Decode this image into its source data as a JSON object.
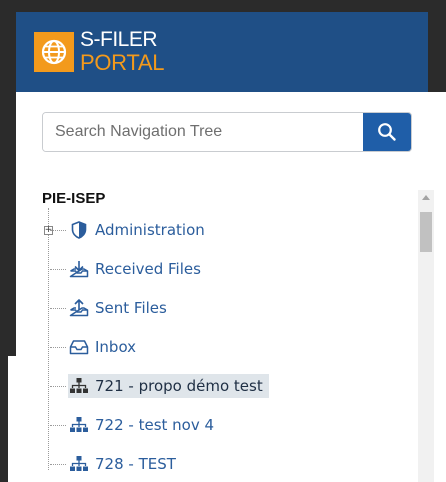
{
  "logo": {
    "line1": "S-FILER",
    "line2": "PORTAL"
  },
  "search": {
    "placeholder": "Search Navigation Tree"
  },
  "tree": {
    "root": "PIE-ISEP",
    "items": [
      {
        "label": "Administration",
        "icon": "shield-icon"
      },
      {
        "label": "Received Files",
        "icon": "download-tray-icon"
      },
      {
        "label": "Sent Files",
        "icon": "upload-tray-icon"
      },
      {
        "label": "Inbox",
        "icon": "inbox-icon"
      },
      {
        "label": "721 - propo démo test",
        "icon": "org-chart-icon",
        "selected": true
      },
      {
        "label": "722 - test nov 4",
        "icon": "org-chart-icon"
      },
      {
        "label": "728 - TEST",
        "icon": "org-chart-icon"
      }
    ]
  },
  "colors": {
    "header": "#1f4f86",
    "logo_accent": "#f39a1c",
    "search_button": "#1f5ea8",
    "tree_link": "#2b5d9c",
    "selected_row": "#dfe5ea"
  }
}
